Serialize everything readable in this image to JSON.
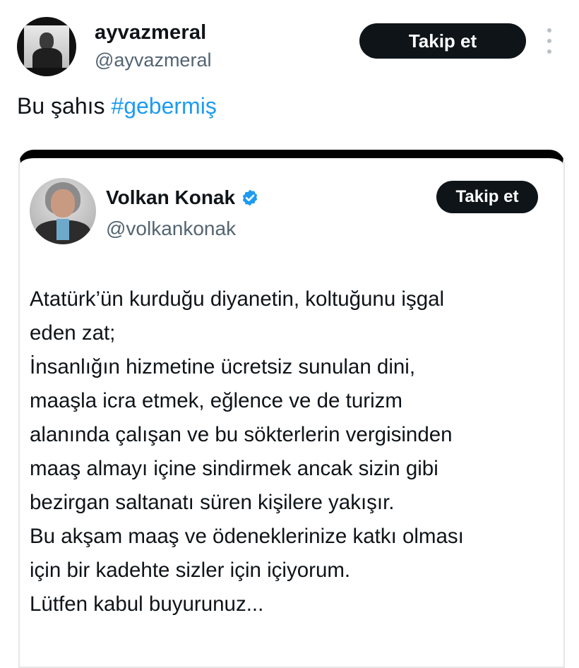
{
  "tweet": {
    "author": {
      "display_name": "ayvazmeral",
      "handle": "@ayvazmeral"
    },
    "follow_label": "Takip et",
    "text": "Bu şahıs",
    "hashtag": "#gebermiş"
  },
  "quoted_screenshot": {
    "author": {
      "display_name": "Volkan Konak",
      "handle": "@volkankonak",
      "verified": true
    },
    "follow_label": "Takip et",
    "lines": [
      "Atatürk’ün kurduğu diyanetin, koltuğunu işgal",
      "eden zat;",
      "İnsanlığın hizmetine ücretsiz sunulan dini,",
      "maaşla icra etmek, eğlence ve de turizm",
      "alanında çalışan ve bu sökterlerin vergisinden",
      "maaş almayı içine sindirmek ancak sizin gibi",
      "bezirgan saltanatı süren kişilere yakışır.",
      "Bu akşam maaş ve ödeneklerinize katkı olması",
      "için bir kadehte sizler için içiyorum.",
      "Lütfen kabul buyurunuz..."
    ]
  },
  "colors": {
    "hashtag": "#1d9bf0",
    "handle": "#536471",
    "button_bg": "#0f1419",
    "verified_badge": "#1d9bf0"
  }
}
